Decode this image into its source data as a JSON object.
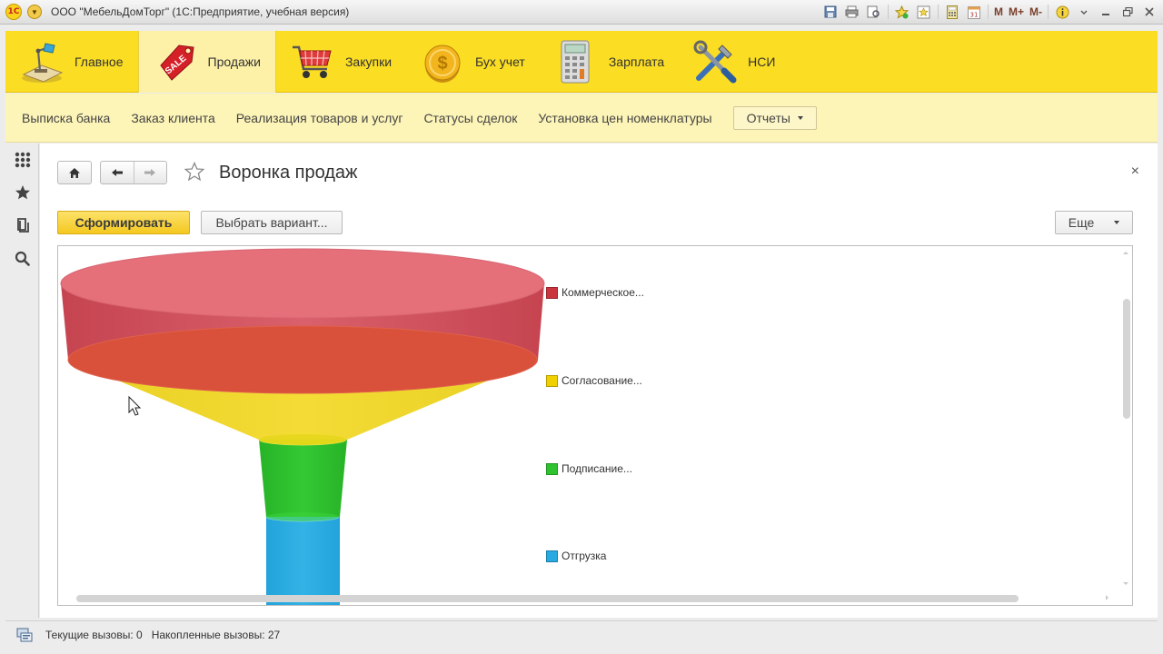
{
  "window": {
    "title": "ООО \"МебельДомТорг\"  (1С:Предприятие, учебная версия)",
    "logo_text": "1С",
    "tools": [
      "save-icon",
      "print-icon",
      "preview-icon",
      "favorite-add-icon",
      "favorites-icon",
      "calculator-icon",
      "calendar-icon",
      "memory-m-icon",
      "memory-plus-icon",
      "memory-minus-icon",
      "info-icon",
      "minimize-icon",
      "restore-icon",
      "close-icon"
    ],
    "memory_labels": {
      "m": "M",
      "m_plus": "M+",
      "m_minus": "M-"
    }
  },
  "sections": [
    {
      "label": "Главное",
      "icon": "desk-lamp-icon"
    },
    {
      "label": "Продажи",
      "icon": "sale-tag-icon",
      "active": true,
      "icon_text": "SALE"
    },
    {
      "label": "Закупки",
      "icon": "shopping-cart-icon"
    },
    {
      "label": "Бух учет",
      "icon": "coin-icon",
      "icon_text": "$"
    },
    {
      "label": "Зарплата",
      "icon": "calculator-icon"
    },
    {
      "label": "НСИ",
      "icon": "tools-icon"
    }
  ],
  "actions": {
    "links": [
      "Выписка банка",
      "Заказ клиента",
      "Реализация товаров и услуг",
      "Статусы сделок",
      "Установка цен номенклатуры"
    ],
    "reports_label": "Отчеты"
  },
  "left_tools": [
    "apps-grid-icon",
    "star-icon",
    "history-icon",
    "search-icon"
  ],
  "form": {
    "title": "Воронка продаж",
    "generate_label": "Сформировать",
    "variant_label": "Выбрать вариант...",
    "more_label": "Еще",
    "close_symbol": "×"
  },
  "chart_data": {
    "type": "funnel",
    "stages": [
      {
        "name": "Коммерческое...",
        "color": "#c9343f"
      },
      {
        "name": "Согласование...",
        "color": "#f0d000"
      },
      {
        "name": "Подписание...",
        "color": "#2ec32e"
      },
      {
        "name": "Отгрузка",
        "color": "#27a9e1"
      }
    ]
  },
  "status": {
    "current_calls": "Текущие вызовы: 0",
    "accumulated_calls": "Накопленные вызовы: 27"
  }
}
